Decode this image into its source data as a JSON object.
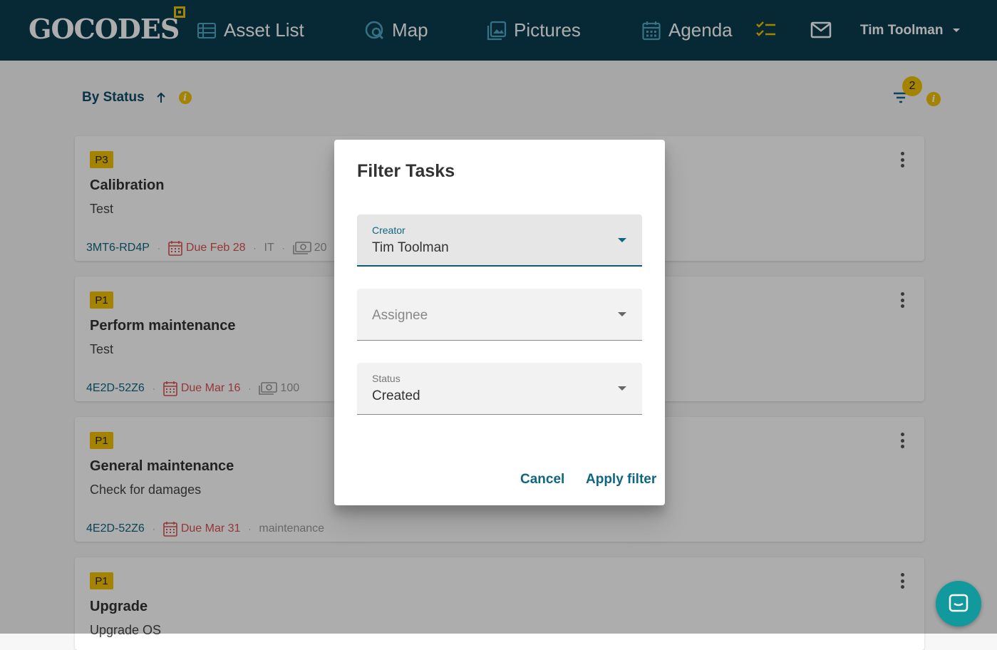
{
  "header": {
    "logo_text": "GOCODES",
    "nav": [
      {
        "label": "Asset List",
        "icon": "list-icon"
      },
      {
        "label": "Map",
        "icon": "map-search-icon"
      },
      {
        "label": "Pictures",
        "icon": "photo-library-icon"
      },
      {
        "label": "Agenda",
        "icon": "calendar-icon"
      }
    ],
    "tasks_icon": "checklist-icon",
    "mail_icon": "mail-icon",
    "user_name": "Tim Toolman"
  },
  "toolbar": {
    "sort_label": "By Status",
    "filter_count": "2"
  },
  "tasks": [
    {
      "priority": "P3",
      "title": "Calibration",
      "description": "Test",
      "code": "3MT6-RD4P",
      "due": "Due Feb 28",
      "tag": "IT",
      "cost": "20"
    },
    {
      "priority": "P1",
      "title": "Perform maintenance",
      "description": "Test",
      "code": "4E2D-52Z6",
      "due": "Due Mar 16",
      "cost": "100"
    },
    {
      "priority": "P1",
      "title": "General maintenance",
      "description": "Check for damages",
      "code": "4E2D-52Z6",
      "due": "Due Mar 31",
      "tag": "maintenance"
    },
    {
      "priority": "P1",
      "title": "Upgrade",
      "description": "Upgrade OS"
    }
  ],
  "dialog": {
    "title": "Filter Tasks",
    "creator_label": "Creator",
    "creator_value": "Tim Toolman",
    "assignee_placeholder": "Assignee",
    "status_label": "Status",
    "status_value": "Created",
    "cancel_label": "Cancel",
    "apply_label": "Apply filter"
  },
  "colors": {
    "header_bg": "#0b3d4e",
    "accent": "#f2c200",
    "link": "#0e6680",
    "due": "#d9534f",
    "chat": "#11999e"
  }
}
